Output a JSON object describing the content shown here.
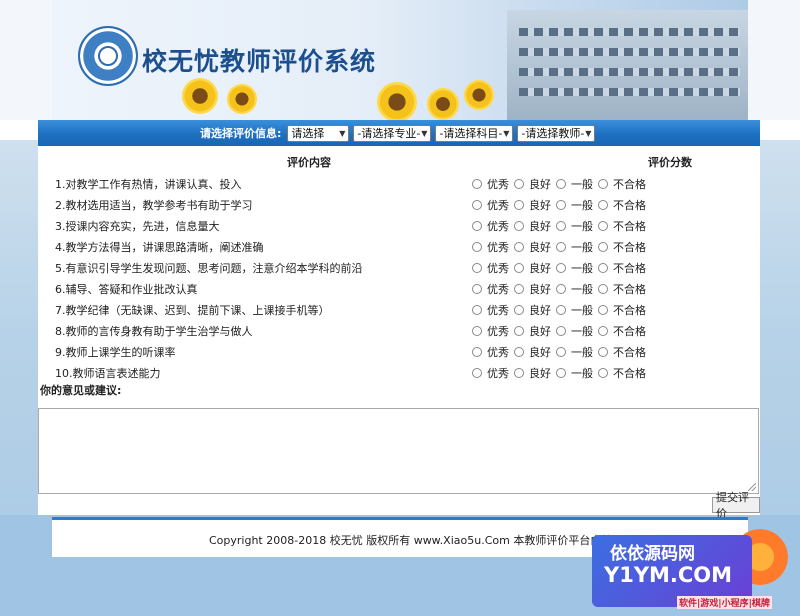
{
  "header": {
    "title": "校无忧教师评价系统"
  },
  "filters": {
    "label": "请选择评价信息:",
    "selects": [
      "请选择",
      "-请选择专业-",
      "-请选择科目-",
      "-请选择教师-"
    ]
  },
  "table": {
    "col_content": "评价内容",
    "col_score": "评价分数",
    "options": [
      "优秀",
      "良好",
      "一般",
      "不合格"
    ],
    "questions": [
      "1.对教学工作有热情，讲课认真、投入",
      "2.教材选用适当，教学参考书有助于学习",
      "3.授课内容充实，先进，信息量大",
      "4.教学方法得当，讲课思路清晰，阐述准确",
      "5.有意识引导学生发现问题、思考问题，注意介绍本学科的前沿",
      "6.辅导、答疑和作业批改认真",
      "7.教学纪律（无缺课、迟到、提前下课、上课接手机等）",
      "8.教师的言传身教有助于学生治学与做人",
      "9.教师上课学生的听课率",
      "10.教师语言表述能力"
    ]
  },
  "comment": {
    "label": "你的意见或建议:",
    "value": ""
  },
  "submit_label": "提交评价",
  "footer": {
    "copyright": "Copyright 2008-2018 校无忧 版权所有 www.Xiao5u.Com 本教师评价平台由校无"
  },
  "watermark": {
    "line1": "依依源码网",
    "line2": "Y1YM.COM",
    "line3": "软件|游戏|小程序|棋牌"
  }
}
